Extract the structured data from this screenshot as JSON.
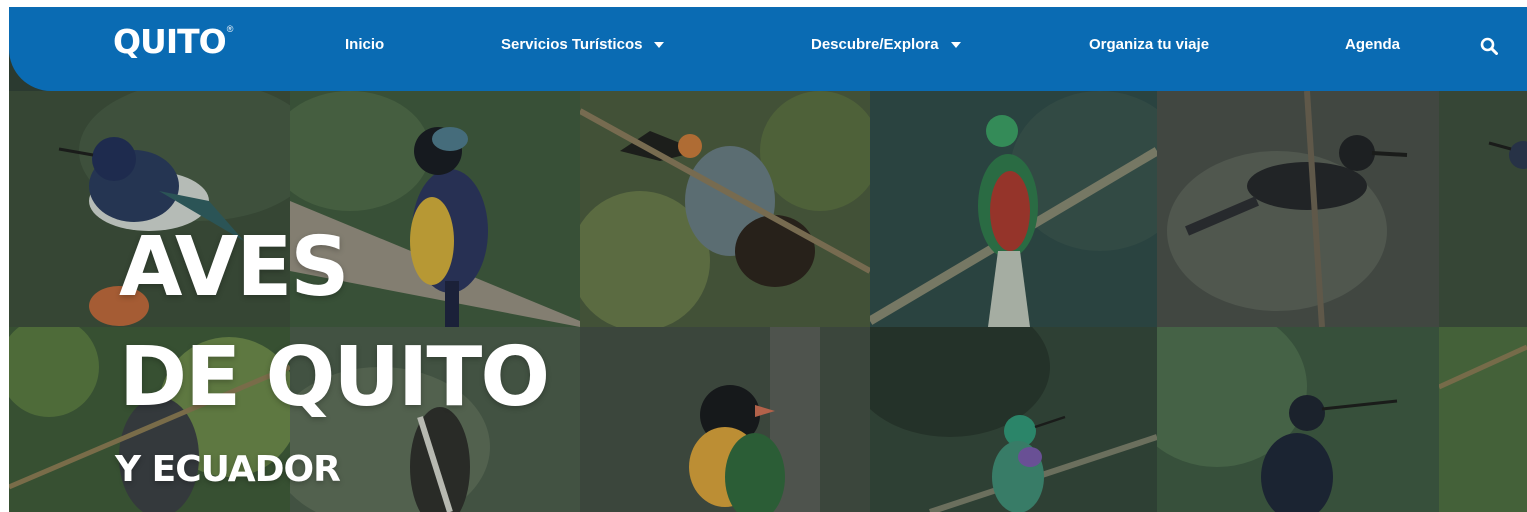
{
  "header": {
    "logo_text": "QUITO",
    "logo_mark": "®",
    "nav": {
      "inicio": "Inicio",
      "servicios": "Servicios Turísticos",
      "descubre": "Descubre/Explora",
      "organiza": "Organiza tu viaje",
      "agenda": "Agenda"
    },
    "search_icon": "search-icon",
    "colors": {
      "bar": "#0a6bb3",
      "text": "#ffffff"
    }
  },
  "hero": {
    "title_line1": "AVES",
    "title_line2": "DE QUITO",
    "subtitle": "Y ECUADOR"
  }
}
